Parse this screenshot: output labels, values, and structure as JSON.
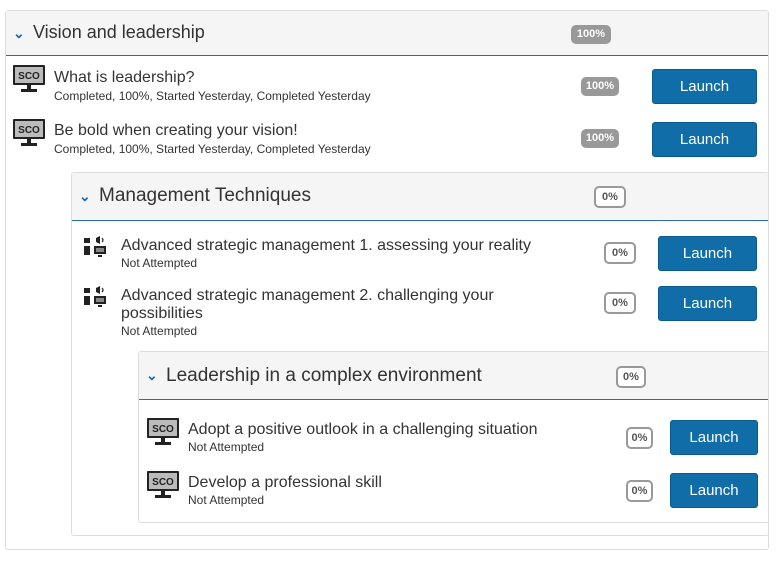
{
  "sections": [
    {
      "title": "Vision and leadership",
      "progress": "100%",
      "items": [
        {
          "title": "What is leadership?",
          "status": "Completed, 100%, Started Yesterday, Completed Yesterday",
          "progress": "100%",
          "action": "Launch",
          "icon": "sco-monitor-icon",
          "icon_label": "SCO"
        },
        {
          "title": "Be bold when creating your vision!",
          "status": "Completed, 100%, Started Yesterday, Completed Yesterday",
          "progress": "100%",
          "action": "Launch",
          "icon": "sco-monitor-icon",
          "icon_label": "SCO"
        }
      ]
    },
    {
      "title": "Management Techniques",
      "progress": "0%",
      "items": [
        {
          "title": "Advanced strategic management 1. assessing your reality",
          "status": "Not Attempted",
          "progress": "0%",
          "action": "Launch",
          "icon": "multimedia-icon"
        },
        {
          "title": "Advanced strategic management 2. challenging your possibilities",
          "status": "Not Attempted",
          "progress": "0%",
          "action": "Launch",
          "icon": "multimedia-icon"
        }
      ]
    },
    {
      "title": "Leadership in a complex environment",
      "progress": "0%",
      "items": [
        {
          "title": "Adopt a positive outlook in a challenging situation",
          "status": "Not Attempted",
          "progress": "0%",
          "action": "Launch",
          "icon": "sco-monitor-icon",
          "icon_label": "SCO"
        },
        {
          "title": "Develop a professional skill",
          "status": "Not Attempted",
          "progress": "0%",
          "action": "Launch",
          "icon": "sco-monitor-icon",
          "icon_label": "SCO"
        }
      ]
    }
  ],
  "colors": {
    "accent": "#106da8",
    "badge_gray": "#999999",
    "header_bg": "#f5f5f5"
  }
}
